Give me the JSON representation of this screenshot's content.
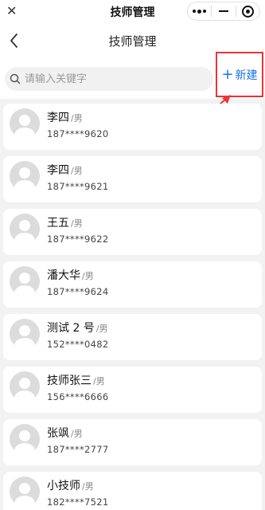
{
  "window": {
    "title": "技师管理"
  },
  "nav": {
    "title": "技师管理"
  },
  "search": {
    "placeholder": "请输入关键字",
    "value": ""
  },
  "actions": {
    "new_label": "新建",
    "plus": "+"
  },
  "colors": {
    "accent": "#1a73e8",
    "highlight": "#ee3333"
  },
  "technicians": [
    {
      "name": "李四",
      "gender": "/男",
      "phone": "187****9620"
    },
    {
      "name": "李四",
      "gender": "/男",
      "phone": "187****9621"
    },
    {
      "name": "王五",
      "gender": "/男",
      "phone": "187****9622"
    },
    {
      "name": "潘大华",
      "gender": "/男",
      "phone": "187****9624"
    },
    {
      "name": "测试 2 号",
      "gender": "/男",
      "phone": "152****0482"
    },
    {
      "name": "技师张三",
      "gender": "/男",
      "phone": "156****6666"
    },
    {
      "name": "张飒",
      "gender": "/男",
      "phone": "187****2777"
    },
    {
      "name": "小技师",
      "gender": "/男",
      "phone": "182****7521"
    }
  ]
}
